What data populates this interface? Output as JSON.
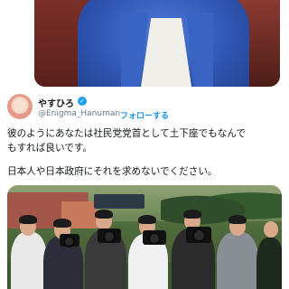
{
  "tweet": {
    "author": {
      "display_name": "やすひろ",
      "handle": "@Enigma_Hanuman",
      "verified": true
    },
    "separator": "·",
    "follow_label": "フォローする",
    "text_lines": [
      "彼のようにあなたは社民党党首として土下座でもなんで",
      "もすれば良いです。",
      "日本人や日本政府にそれを求めないでください。"
    ]
  },
  "icons": {
    "verified": "verified-badge-icon"
  },
  "colors": {
    "link": "#1b95e0",
    "verified": "#1da1f2",
    "muted": "#657786",
    "text": "#14171a"
  }
}
